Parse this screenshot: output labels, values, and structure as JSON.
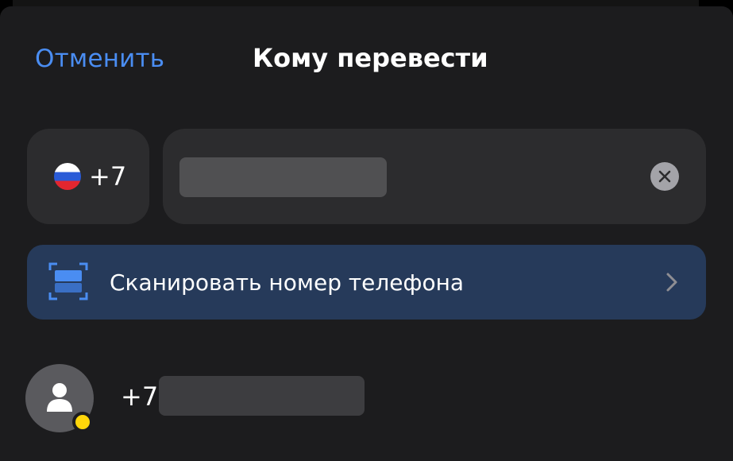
{
  "header": {
    "cancel_label": "Отменить",
    "title": "Кому перевести"
  },
  "phone_input": {
    "country_flag_icon": "russia-flag-icon",
    "country_code": "+7",
    "value": "",
    "clear_icon": "clear-circle-icon"
  },
  "scan": {
    "icon": "scan-frame-icon",
    "label": "Сканировать номер телефона",
    "chevron_icon": "chevron-right-icon"
  },
  "recent_contacts": [
    {
      "avatar_icon": "person-icon",
      "phone_prefix": "+7",
      "status_color": "#ffd60a"
    }
  ],
  "colors": {
    "accent": "#4a8df2",
    "sheet_background": "#1c1c1e",
    "field_background": "#2c2c2e",
    "scan_background": "#263a5a",
    "status_dot": "#ffd60a"
  }
}
